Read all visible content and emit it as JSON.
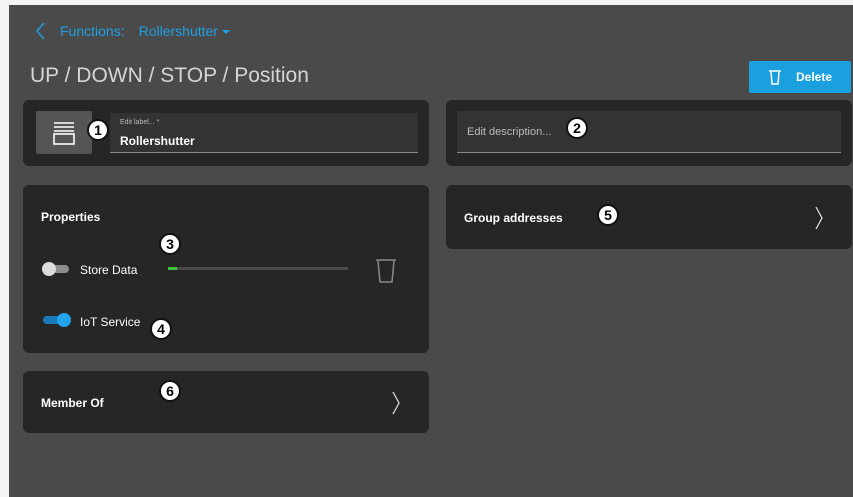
{
  "breadcrumb": {
    "parent": "Functions:",
    "current": "Rollershutter"
  },
  "page_title": "UP / DOWN / STOP / Position",
  "delete_button": {
    "label": "Delete"
  },
  "label_card": {
    "placeholder": "Edit label... *",
    "value": "Rollershutter",
    "icon": "rollershutter-icon"
  },
  "description_card": {
    "placeholder": "Edit description..."
  },
  "properties": {
    "title": "Properties",
    "store_data": {
      "label": "Store Data",
      "enabled": false,
      "progress": 0.05
    },
    "iot_service": {
      "label": "IoT Service",
      "enabled": true
    }
  },
  "member_of": {
    "label": "Member Of"
  },
  "group_addresses": {
    "label": "Group addresses"
  },
  "markers": [
    "1",
    "2",
    "3",
    "4",
    "5",
    "6"
  ],
  "colors": {
    "accent": "#1fa0e0",
    "progress": "#3cc43c",
    "card": "#262626",
    "background": "#4a4a4a"
  }
}
